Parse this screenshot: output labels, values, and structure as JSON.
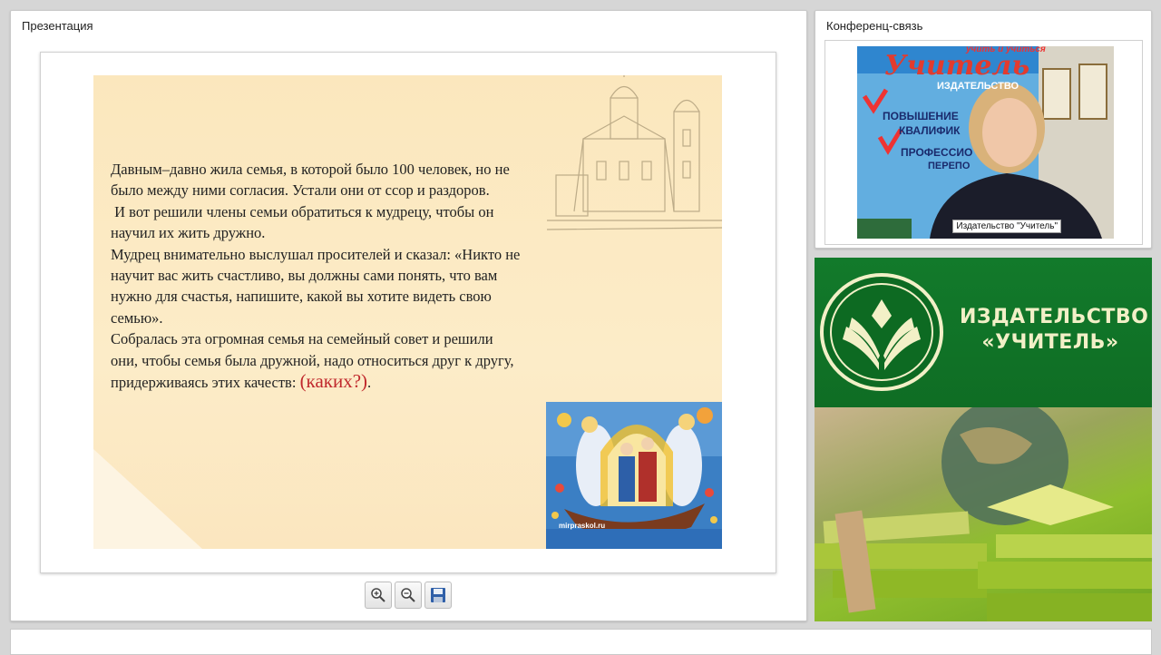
{
  "presentation": {
    "title": "Презентация",
    "slide": {
      "lines": [
        "Давным–давно жила семья, в которой было 100 человек, но не",
        "было между ними согласия. Устали они от ссор и раздоров.",
        " И вот решили члены семьи обратиться к мудрецу, чтобы он",
        "научил их жить дружно.",
        "Мудрец внимательно выслушал просителей и сказал: «Никто не",
        "научит вас жить счастливо, вы должны сами понять, что вам",
        "нужно для счастья, напишите, какой вы хотите видеть свою",
        "семью».",
        "Собралась эта огромная семья на семейный совет и решили",
        "они, чтобы семья была дружной, надо относиться друг к другу,"
      ],
      "last_line_prefix": "придерживаясь этих качеств: ",
      "last_line_question": "(каких?)",
      "last_line_suffix": ".",
      "image_caption": "mirpraskol.ru"
    },
    "toolbar": {
      "zoom_in_icon": "zoom-in-icon",
      "zoom_out_icon": "zoom-out-icon",
      "save_icon": "floppy-disk-icon"
    }
  },
  "conference": {
    "title": "Конференц-связь",
    "video_label": "Издательство \"Учитель\"",
    "background_poster": {
      "headline": "Учитель",
      "sub": "издательство",
      "top_line": "учить и учиться",
      "items": [
        "повышение",
        "квалифик",
        "профессио",
        "перепо"
      ]
    }
  },
  "banner": {
    "name_line1": "ИЗДАТЕЛЬСТВО",
    "name_line2": "«УЧИТЕЛЬ»",
    "colors": {
      "green": "#127a2b",
      "cream": "#f2f0c7",
      "lime": "#8fbe2e"
    }
  }
}
